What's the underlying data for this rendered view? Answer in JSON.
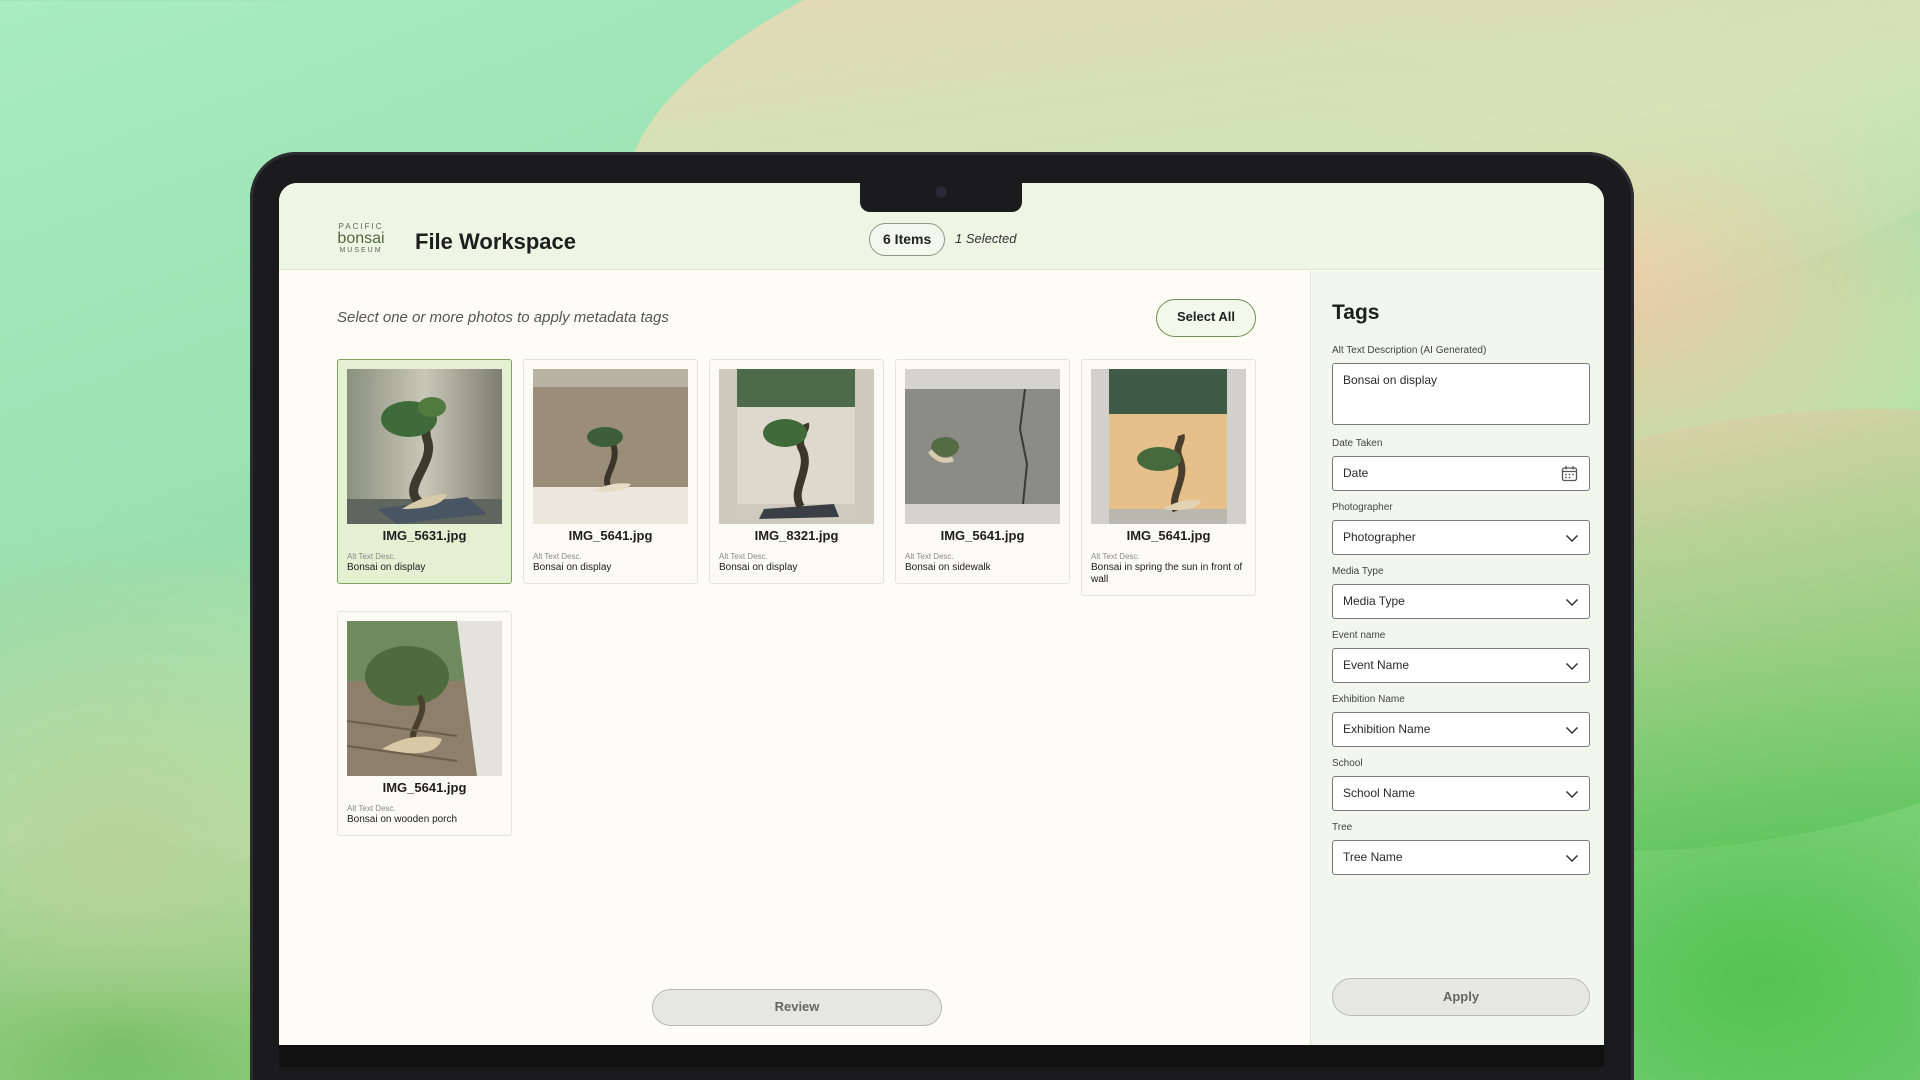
{
  "app": {
    "logo": {
      "line1": "PACIFIC",
      "line2": "bonsai",
      "line3": "MUSEUM"
    },
    "title": "File Workspace",
    "item_count": "6 Items",
    "selected_count": "1 Selected"
  },
  "main": {
    "instruction": "Select one or more photos to apply metadata tags",
    "select_all_label": "Select All",
    "review_label": "Review",
    "alt_label": "Alt Text Desc.",
    "photos": [
      {
        "filename": "IMG_5631.jpg",
        "alt": "Bonsai on display",
        "selected": true
      },
      {
        "filename": "IMG_5641.jpg",
        "alt": "Bonsai on display",
        "selected": false
      },
      {
        "filename": "IMG_8321.jpg",
        "alt": "Bonsai on display",
        "selected": false
      },
      {
        "filename": "IMG_5641.jpg",
        "alt": "Bonsai on sidewalk",
        "selected": false
      },
      {
        "filename": "IMG_5641.jpg",
        "alt": "Bonsai in spring the sun in front of wall",
        "selected": false
      },
      {
        "filename": "IMG_5641.jpg",
        "alt": "Bonsai on wooden porch",
        "selected": false
      }
    ]
  },
  "sidebar": {
    "title": "Tags",
    "alt_text": {
      "label": "Alt Text Description (AI Generated)",
      "value": "Bonsai on display"
    },
    "date_taken": {
      "label": "Date Taken",
      "placeholder": "Date"
    },
    "photographer": {
      "label": "Photographer",
      "value": "Photographer"
    },
    "media_type": {
      "label": "Media Type",
      "value": "Media Type"
    },
    "event_name": {
      "label": "Event name",
      "value": "Event Name"
    },
    "exhibition_name": {
      "label": "Exhibition Name",
      "value": "Exhibition Name"
    },
    "school": {
      "label": "School",
      "value": "School Name"
    },
    "tree": {
      "label": "Tree",
      "value": "Tree Name"
    },
    "apply_label": "Apply"
  },
  "colors": {
    "accent": "#7fa45f",
    "header_bg": "#eef5e4",
    "selected_card_bg": "#e3f0d2"
  }
}
